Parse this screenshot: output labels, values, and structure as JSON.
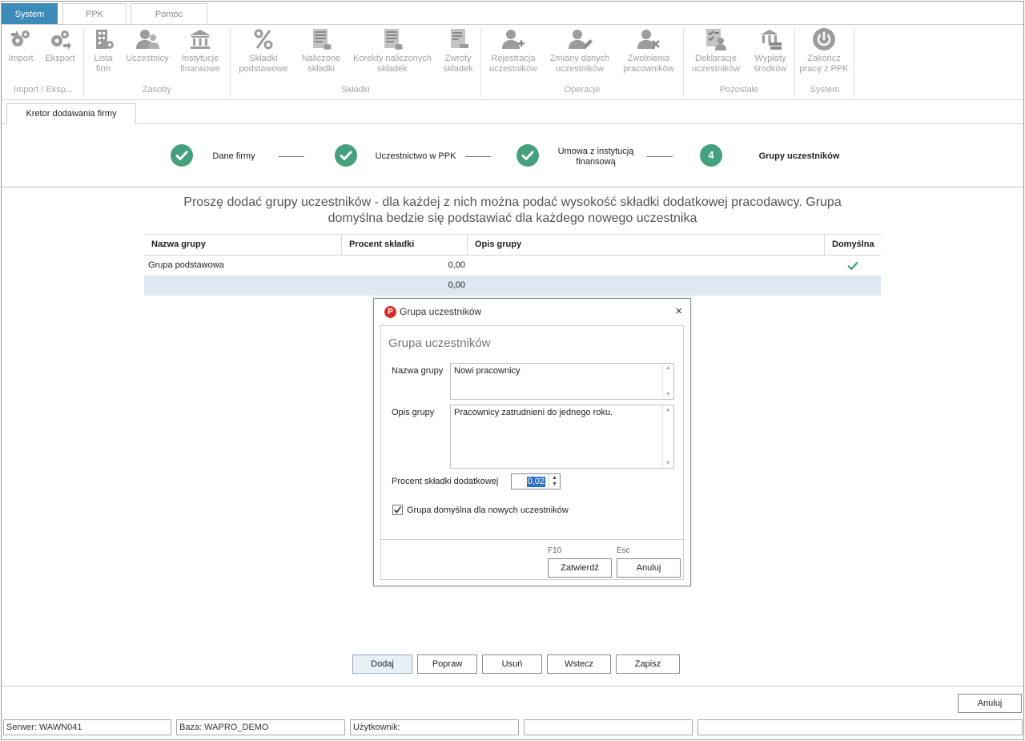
{
  "top_tabs": [
    "System",
    "PPK",
    "Pomoc"
  ],
  "ribbon": {
    "buttons": [
      {
        "line1": "Import",
        "line2": "",
        "icon": "gears-import-icon"
      },
      {
        "line1": "Eksport",
        "line2": "",
        "icon": "gears-export-icon"
      },
      {
        "line1": "Lista",
        "line2": "firm",
        "icon": "building-icon"
      },
      {
        "line1": "Uczestnicy",
        "line2": "",
        "icon": "users-icon"
      },
      {
        "line1": "Instytucje",
        "line2": "finansowe",
        "icon": "bank-icon"
      },
      {
        "line1": "Składki",
        "line2": "podstawowe",
        "icon": "percent-icon"
      },
      {
        "line1": "Naliczone",
        "line2": "składki",
        "icon": "calculated-contributions-icon"
      },
      {
        "line1": "Korekty naliczonych",
        "line2": "składek",
        "icon": "corrections-icon"
      },
      {
        "line1": "Zwroty",
        "line2": "składek",
        "icon": "refund-icon"
      },
      {
        "line1": "Rejestracja",
        "line2": "uczestników",
        "icon": "user-add-icon"
      },
      {
        "line1": "Zmiany danych",
        "line2": "uczestników",
        "icon": "user-edit-icon"
      },
      {
        "line1": "Zwolnienia",
        "line2": "pracowników",
        "icon": "user-remove-icon"
      },
      {
        "line1": "Deklaracje",
        "line2": "uczestników",
        "icon": "declaration-icon"
      },
      {
        "line1": "Wypłaty",
        "line2": "środków",
        "icon": "payout-icon"
      },
      {
        "line1": "Zakończ",
        "line2": "pracę z PPK",
        "icon": "power-icon"
      }
    ],
    "groups": [
      "Import / Eksp...",
      "Zasoby",
      "Składki",
      "Operacje",
      "Pozostałe",
      "System"
    ]
  },
  "doc_tab": "Kretor dodawania firmy",
  "wizard": {
    "steps": [
      {
        "label": "Dane firmy",
        "label2": "",
        "number": ""
      },
      {
        "label": "Uczestnictwo w PPK",
        "label2": "",
        "number": ""
      },
      {
        "label": "Umowa z instytucją",
        "label2": "finansową",
        "number": ""
      },
      {
        "label": "Grupy uczestników",
        "label2": "",
        "number": "4"
      }
    ]
  },
  "heading": {
    "line1": "Proszę dodać grupy uczestników - dla każdej z nich można podać wysokość składki dodatkowej pracodawcy. Grupa",
    "line2": "domyślna bedzie się podstawiać dla każdego nowego uczestnika"
  },
  "grid": {
    "columns": [
      "Nazwa grupy",
      "Procent składki",
      "Opis grupy",
      "Domyślna"
    ],
    "rows": [
      {
        "name": "Grupa podstawowa",
        "percent": "0,00",
        "desc": "",
        "default": true
      },
      {
        "name": "",
        "percent": "0,00",
        "desc": "",
        "default": false
      }
    ]
  },
  "dialog": {
    "title": "Grupa uczestników",
    "logo_letter": "P",
    "close": "×",
    "heading": "Grupa uczestników",
    "name_label": "Nazwa grupy",
    "name_value": "Nowi pracownicy",
    "desc_label": "Opis grupy",
    "desc_value": "Pracownicy zatrudnieni do jednego roku.",
    "percent_label": "Procent składki dodatkowej",
    "percent_value": "0,02",
    "default_label": "Grupa domyślna dla nowych uczestników",
    "default_checked": true,
    "confirm_hint": "F10",
    "confirm_label": "Zatwierdź",
    "cancel_hint": "Esc",
    "cancel_label": "Anuluj"
  },
  "actions": [
    "Dodaj",
    "Popraw",
    "Usuń",
    "Wstecz",
    "Zapisz"
  ],
  "window_cancel": "Anuluj",
  "status_bar": [
    "Serwer: WAWN041",
    "Baza: WAPRO_DEMO",
    "Użytkownik:",
    "",
    ""
  ],
  "colors": {
    "accent": "#3c8bb8",
    "step_done": "#45a07e",
    "selected_row": "#dde8f3",
    "check_green": "#45a07e",
    "logo_red": "#d9302c"
  }
}
